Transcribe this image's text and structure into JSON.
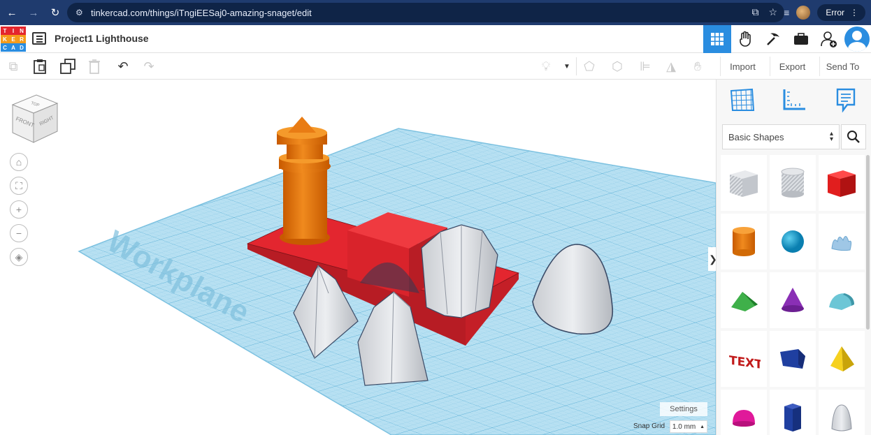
{
  "browser": {
    "url": "tinkercad.com/things/iTngiEESaj0-amazing-snaget/edit",
    "error_label": "Error"
  },
  "app": {
    "logo_letters": [
      "T",
      "I",
      "N",
      "K",
      "E",
      "R",
      "C",
      "A",
      "D"
    ],
    "logo_colors": [
      "#e4262d",
      "#e4262d",
      "#e4262d",
      "#f59b1a",
      "#f59b1a",
      "#f59b1a",
      "#2a8de0",
      "#2a8de0",
      "#2a8de0"
    ],
    "project_title": "Project1 Lighthouse",
    "accent": "#2a8de0"
  },
  "toolbar": {
    "import_label": "Import",
    "export_label": "Export",
    "send_to_label": "Send To"
  },
  "viewport": {
    "cube_labels": {
      "top": "TOP",
      "front": "FRONT",
      "right": "RIGHT"
    },
    "workplane_label": "Workplane",
    "settings_label": "Settings",
    "snap_grid_label": "Snap Grid",
    "snap_grid_value": "1.0 mm"
  },
  "sidebar": {
    "category": "Basic Shapes",
    "shapes": [
      {
        "name": "box-hole-icon"
      },
      {
        "name": "cylinder-hole-icon"
      },
      {
        "name": "box-icon"
      },
      {
        "name": "cylinder-icon"
      },
      {
        "name": "sphere-icon"
      },
      {
        "name": "scribble-icon"
      },
      {
        "name": "roof-icon"
      },
      {
        "name": "cone-icon"
      },
      {
        "name": "round-roof-icon"
      },
      {
        "name": "text-icon"
      },
      {
        "name": "polygon-icon"
      },
      {
        "name": "pyramid-icon"
      },
      {
        "name": "half-sphere-icon"
      },
      {
        "name": "hexagonal-prism-icon"
      },
      {
        "name": "paraboloid-icon"
      }
    ],
    "text_shape_label": "TEXT"
  }
}
